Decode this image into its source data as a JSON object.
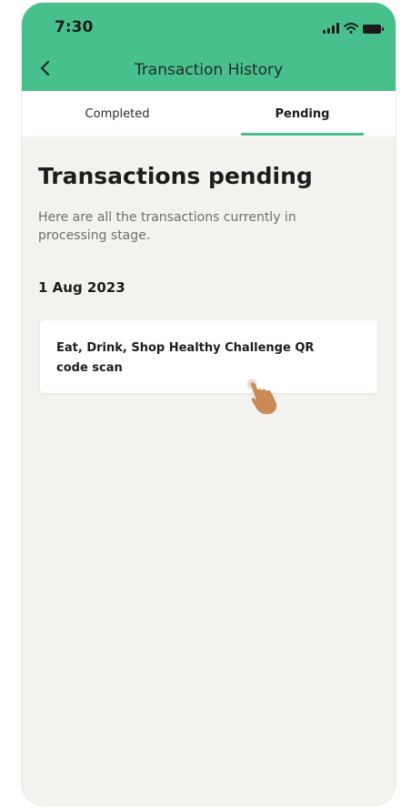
{
  "status_bar": {
    "time": "7:30",
    "icons": [
      "signal-icon",
      "wifi-icon",
      "battery-icon"
    ]
  },
  "header": {
    "title": "Transaction History",
    "back_icon": "chevron-left-icon",
    "color": "#48c08b"
  },
  "tabs": [
    {
      "label": "Completed",
      "active": false
    },
    {
      "label": "Pending",
      "active": true
    }
  ],
  "main": {
    "heading": "Transactions pending",
    "description": "Here are all the transactions currently in processing stage.",
    "groups": [
      {
        "date": "1 Aug 2023",
        "items": [
          {
            "title": "Eat, Drink, Shop Healthy Challenge QR code scan"
          }
        ]
      }
    ]
  },
  "colors": {
    "accent": "#48c08b",
    "background": "#f3f2ef",
    "card": "#ffffff"
  }
}
